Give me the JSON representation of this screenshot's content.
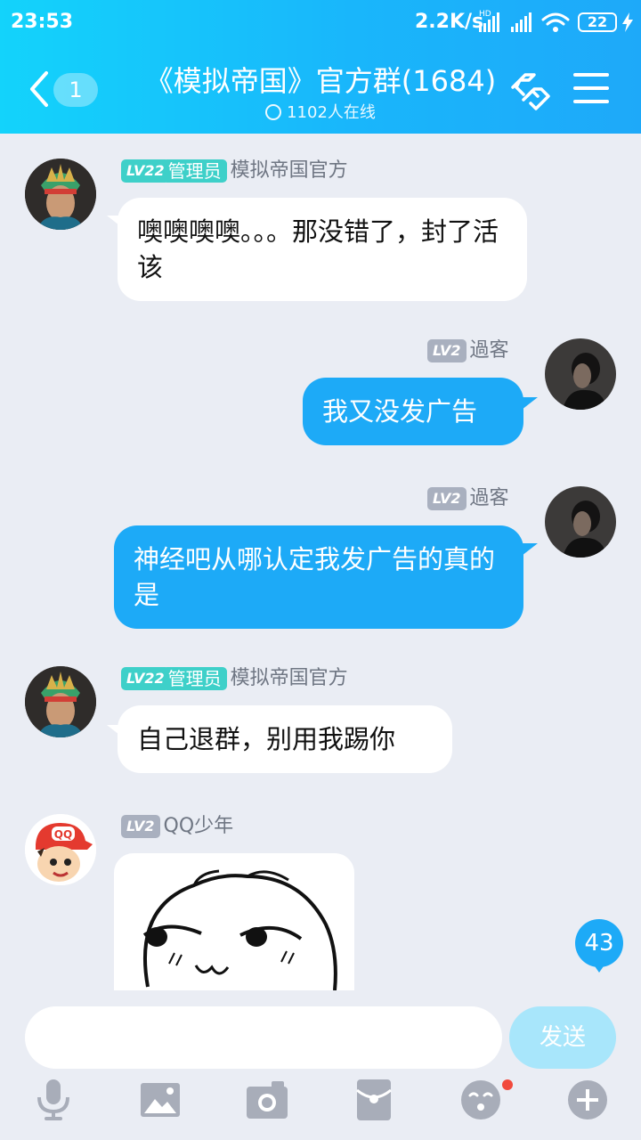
{
  "status_bar": {
    "time": "23:53",
    "network_speed": "2.2K/s",
    "network_type": "HD",
    "battery": "22"
  },
  "header": {
    "back_count": "1",
    "title": "《模拟帝国》官方群(1684)",
    "online": "1102人在线"
  },
  "messages": [
    {
      "side": "in",
      "level": "LV22",
      "role": "管理员",
      "nickname": "模拟帝国官方",
      "text": "噢噢噢噢。。。那没错了，封了活该"
    },
    {
      "side": "out",
      "level": "LV2",
      "nickname": "過客",
      "text": "我又没发广告"
    },
    {
      "side": "out",
      "level": "LV2",
      "nickname": "過客",
      "text": "神经吧从哪认定我发广告的真的是"
    },
    {
      "side": "in",
      "level": "LV22",
      "role": "管理员",
      "nickname": "模拟帝国官方",
      "text": "自己退群，别用我踢你"
    },
    {
      "side": "in",
      "level": "LV2",
      "nickname": "QQ少年",
      "type": "sticker",
      "avatar_text": "QQ"
    }
  ],
  "new_messages_count": "43",
  "composer": {
    "input_value": "",
    "send_label": "发送"
  },
  "toolbar": [
    "microphone-icon",
    "image-icon",
    "camera-icon",
    "red-packet-icon",
    "emoji-icon",
    "plus-icon"
  ],
  "colors": {
    "header_start": "#13d3fb",
    "header_end": "#1ea9f9",
    "outgoing_bubble": "#1daaf7",
    "admin_badge": "#3ed0c9",
    "level_badge": "#a9b0bf",
    "background": "#eaedf4"
  }
}
